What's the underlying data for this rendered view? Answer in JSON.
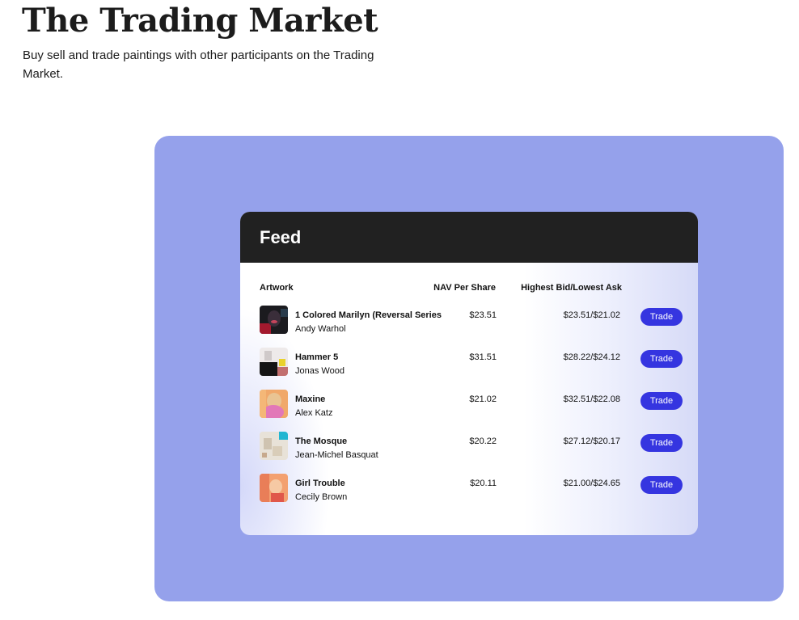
{
  "header": {
    "title": "The Trading Market",
    "subtitle": "Buy sell and trade paintings with other participants on the Trading Market."
  },
  "feed": {
    "title": "Feed",
    "columns": {
      "artwork": "Artwork",
      "nav": "NAV Per Share",
      "bid_ask": "Highest Bid/Lowest Ask"
    },
    "rows": [
      {
        "title": "1 Colored Marilyn (Reversal Series",
        "artist": "Andy Warhol",
        "nav": "$23.51",
        "bid_ask": "$23.51/$21.02",
        "action": "Trade"
      },
      {
        "title": "Hammer 5",
        "artist": "Jonas Wood",
        "nav": "$31.51",
        "bid_ask": "$28.22/$24.12",
        "action": "Trade"
      },
      {
        "title": "Maxine",
        "artist": "Alex Katz",
        "nav": "$21.02",
        "bid_ask": "$32.51/$22.08",
        "action": "Trade"
      },
      {
        "title": "The Mosque",
        "artist": "Jean-Michel Basquat",
        "nav": "$20.22",
        "bid_ask": "$27.12/$20.17",
        "action": "Trade"
      },
      {
        "title": "Girl Trouble",
        "artist": "Cecily Brown",
        "nav": "$20.11",
        "bid_ask": "$21.00/$24.65",
        "action": "Trade"
      }
    ]
  },
  "colors": {
    "panel": "#95a1eb",
    "feed_header": "#212121",
    "trade_button": "#3535e0"
  }
}
